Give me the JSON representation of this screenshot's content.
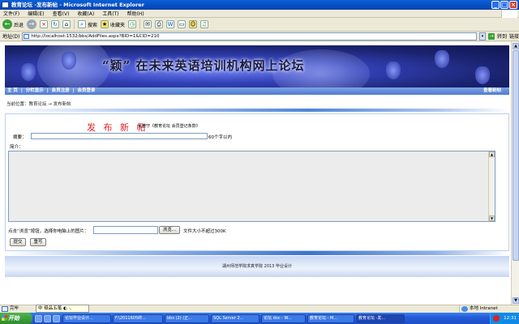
{
  "window": {
    "title": "教育论坛 -发布新帖 - Microsoft Internet Explorer"
  },
  "menu": [
    "文件(F)",
    "编辑(E)",
    "查看(V)",
    "收藏(A)",
    "工具(T)",
    "帮助(H)"
  ],
  "toolbar": {
    "back": "后退",
    "search": "搜索",
    "favorites": "收藏夹"
  },
  "address": {
    "label": "地址(D)",
    "url": "http://localhost:1532/bbs/AddFiles.aspx?BID=1&CID=210",
    "go": "转到",
    "links": "链接"
  },
  "banner": {
    "slogan": "“颖” 在未来英语培训机构网上论坛"
  },
  "nav": {
    "items": [
      "主  页",
      "|",
      "分栏显示",
      "|",
      "会员注册",
      "|",
      "会员登录"
    ],
    "register": "查看新帖"
  },
  "breadcrumb": {
    "prefix": "当前位置：",
    "forum": "教育论坛",
    "arrow": "→",
    "page": "发布新帖"
  },
  "form": {
    "title": "发 布 新 帖",
    "note": "请遵守《教育论坛 会员登记条款》",
    "summary_label": "摘要：",
    "summary_hint": "60个字以内",
    "intro_label": "简介：",
    "attach_label": "点击“浏览”按钮，选择你电脑上的图片：",
    "browse": "浏览...",
    "size_hint": "文件大小不超过300K",
    "submit": "提交",
    "reset": "重写"
  },
  "footer": {
    "text": "湖州师范学院求真学院   2013   毕业设计"
  },
  "status": {
    "text": "完毕",
    "zone": "本地 Intranet"
  },
  "ime": {
    "text": "中 极品五笔 ◐ ·,"
  },
  "taskbar": {
    "start": "开始",
    "tasks": [
      "论坛毕业设计...",
      "F:\\2011605终...",
      "bbs (2) (正...",
      "SQL Server 2...",
      "论坛 doc - W...",
      "教育论坛 - M...",
      "教育论坛 -发..."
    ],
    "clock": "12:31"
  }
}
